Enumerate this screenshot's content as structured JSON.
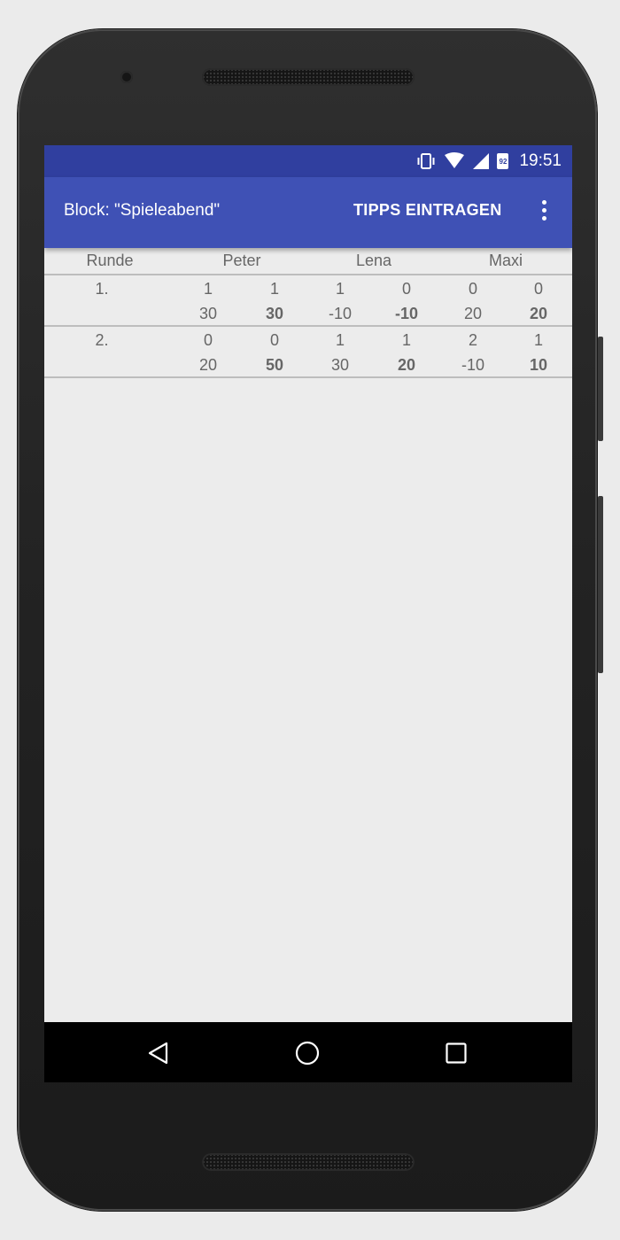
{
  "status_bar": {
    "time": "19:51",
    "battery_level": "92",
    "icons": [
      "vibrate-icon",
      "wifi-icon",
      "cell-signal-icon",
      "battery-icon"
    ]
  },
  "app_bar": {
    "title": "Block: \"Spieleabend\"",
    "action_label": "TIPPS EINTRAGEN",
    "overflow_icon": "more-vert-icon"
  },
  "table": {
    "headers": [
      "Runde",
      "Peter",
      "Lena",
      "Maxi"
    ],
    "rounds": [
      {
        "label": "1.",
        "bids": [
          "1",
          "1",
          "1",
          "0",
          "0",
          "0"
        ],
        "scores": [
          "30",
          "30",
          "-10",
          "-10",
          "20",
          "20"
        ]
      },
      {
        "label": "2.",
        "bids": [
          "0",
          "0",
          "1",
          "1",
          "2",
          "1"
        ],
        "scores": [
          "20",
          "50",
          "30",
          "20",
          "-10",
          "10"
        ]
      }
    ]
  },
  "nav_bar": {
    "icons": [
      "back-icon",
      "home-icon",
      "recents-icon"
    ]
  },
  "colors": {
    "status_bar": "#303f9f",
    "app_bar": "#3f51b5",
    "background": "#ececec",
    "text": "#666666"
  }
}
